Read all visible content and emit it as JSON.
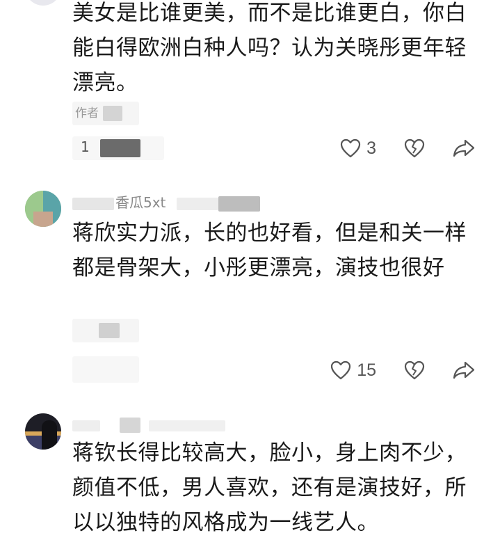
{
  "comments": [
    {
      "username": "",
      "text": "美女是比谁更美，而不是比谁更白，你白能白得欧洲白种人吗？认为关晓彤更年轻漂亮。",
      "meta_author": "作者",
      "meta_time": "1",
      "likes": "3"
    },
    {
      "username": "香瓜5xt",
      "text": "蒋欣实力派，长的也好看，但是和关一样都是骨架大，小彤更漂亮，演技也很好",
      "meta_author": "",
      "meta_time": "",
      "likes": "15"
    },
    {
      "username": "",
      "text": "蒋钦长得比较高大，脸小，身上肉不少，颜值不低，男人喜欢，还有是演技好，所以以独特的风格成为一线艺人。",
      "meta_author": "",
      "meta_time": "",
      "likes": ""
    }
  ],
  "icons": {
    "like": "heart-outline-icon",
    "dislike": "broken-heart-icon",
    "share": "share-arrow-icon"
  },
  "colors": {
    "text": "#1a1a1a",
    "muted": "#8a8a8a",
    "icon": "#555555"
  }
}
